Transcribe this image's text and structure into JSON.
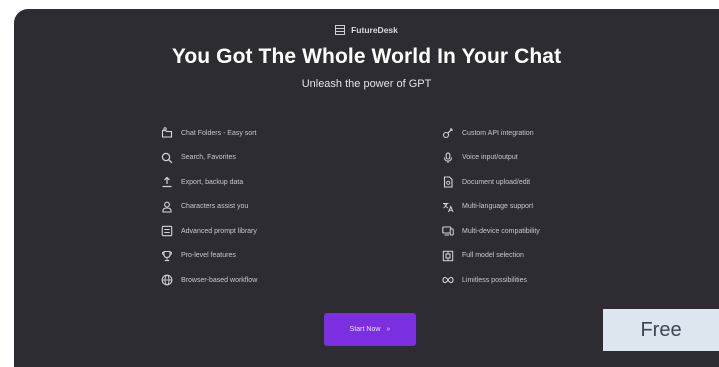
{
  "brand": {
    "icon": "grid-logo-icon",
    "name": "FutureDesk"
  },
  "hero": {
    "title": "You Got The Whole World In Your Chat",
    "subtitle": "Unleash the power of GPT"
  },
  "features_left": [
    {
      "icon": "folder-icon",
      "label": "Chat Folders - Easy sort"
    },
    {
      "icon": "search-icon",
      "label": "Search, Favorites"
    },
    {
      "icon": "upload-icon",
      "label": "Export, backup data"
    },
    {
      "icon": "user-icon",
      "label": "Characters assist you"
    },
    {
      "icon": "list-icon",
      "label": "Advanced prompt library"
    },
    {
      "icon": "trophy-icon",
      "label": "Pro-level features"
    },
    {
      "icon": "globe-icon",
      "label": "Browser-based workflow"
    }
  ],
  "features_right": [
    {
      "icon": "plug-icon",
      "label": "Custom API integration"
    },
    {
      "icon": "microphone-icon",
      "label": "Voice input/output"
    },
    {
      "icon": "document-icon",
      "label": "Document upload/edit"
    },
    {
      "icon": "translate-icon",
      "label": "Multi-language support"
    },
    {
      "icon": "devices-icon",
      "label": "Multi-device compatibility"
    },
    {
      "icon": "chip-icon",
      "label": "Full model selection"
    },
    {
      "icon": "infinity-icon",
      "label": "Limitless possibilities"
    }
  ],
  "cta": {
    "label": "Start Now",
    "arrow": "»"
  },
  "badge": {
    "label": "Free"
  },
  "colors": {
    "card_bg": "#2e2c33",
    "accent": "#7b2fe0",
    "badge_bg": "#dde6ef"
  }
}
